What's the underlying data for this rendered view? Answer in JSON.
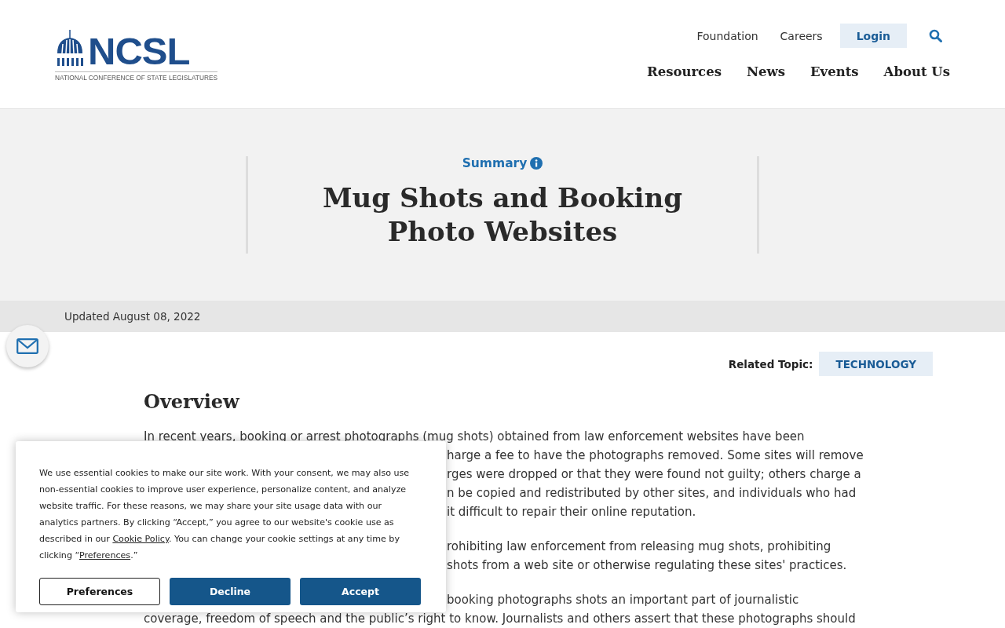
{
  "header": {
    "logo": {
      "name": "NCSL",
      "tagline": "NATIONAL CONFERENCE OF STATE LEGISLATURES"
    },
    "utility_nav": [
      "Foundation",
      "Careers"
    ],
    "login": "Login",
    "main_nav": [
      "Resources",
      "News",
      "Events",
      "About Us"
    ]
  },
  "hero": {
    "eyebrow": "Summary",
    "title": "Mug Shots and Booking Photo Websites"
  },
  "updated": "Updated August 08, 2022",
  "related_topic": {
    "label": "Related Topic:",
    "tag": "TECHNOLOGY"
  },
  "article": {
    "heading": "Overview",
    "paragraphs": [
      {
        "lines": [
          {
            "kind": "full",
            "text": "In recent years, booking or arrest photographs (mug shots) obtained from law enforcement websites have been"
          },
          {
            "kind": "partial",
            "text": "harge a fee to have the photographs removed. Some sites will remove"
          },
          {
            "kind": "partial",
            "text": "rges were dropped or that they were found not guilty; others charge a"
          },
          {
            "kind": "partial",
            "text": "n be copied and redistributed by other sites, and individuals who had"
          },
          {
            "kind": "partial",
            "text": "it difficult to repair their online reputation."
          }
        ]
      },
      {
        "lines": [
          {
            "kind": "partial",
            "text": "rohibiting law enforcement from releasing mug shots, prohibiting"
          },
          {
            "kind": "partial",
            "text": "shots from a web site or otherwise regulating these sites' practices."
          }
        ]
      },
      {
        "lines": [
          {
            "kind": "partial",
            "text": "booking photographs shots an important part of journalistic"
          },
          {
            "kind": "full",
            "text": "coverage, freedom of speech and the public’s right to know. Journalists and others assert that these photographs should"
          }
        ]
      }
    ]
  },
  "cookie_banner": {
    "segments": [
      {
        "kind": "text",
        "text": "We use essential cookies to make our site work. With your consent, we may also use non-essential cookies to improve user experience, personalize content, and analyze website traffic. For these reasons, we may share your site usage data with our analytics partners. By clicking “Accept,” you agree to our website's cookie use as described in our "
      },
      {
        "kind": "link",
        "text": "Cookie Policy"
      },
      {
        "kind": "text",
        "text": ". You can change your cookie settings at any time by clicking “"
      },
      {
        "kind": "link",
        "text": "Preferences"
      },
      {
        "kind": "text",
        "text": ".”"
      }
    ],
    "buttons": [
      {
        "kind": "outline",
        "label": "Preferences"
      },
      {
        "kind": "filled",
        "label": "Decline"
      },
      {
        "kind": "filled",
        "label": "Accept"
      }
    ]
  }
}
